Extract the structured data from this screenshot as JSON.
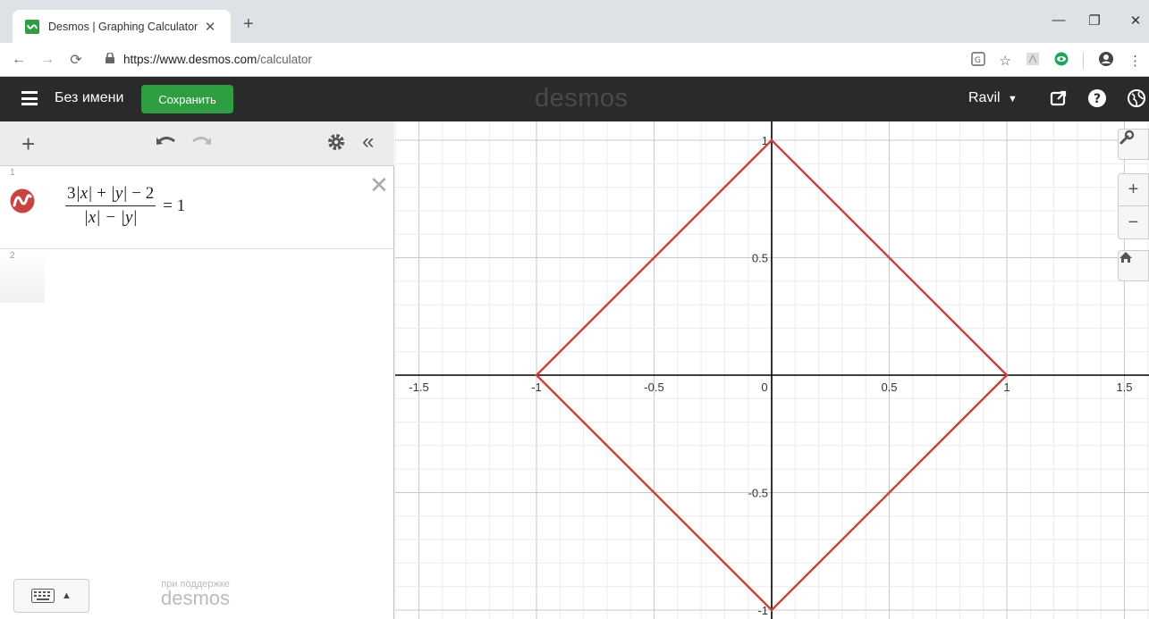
{
  "browser": {
    "tab_title": "Desmos | Graphing Calculator",
    "url_host": "https://www.desmos.com",
    "url_path": "/calculator"
  },
  "header": {
    "graph_title": "Без имени",
    "save_label": "Сохранить",
    "logo": "desmos",
    "user_name": "Ravil"
  },
  "expressions": [
    {
      "row": "1",
      "num_parts": [
        "3",
        "|x|",
        " + ",
        "|y|",
        " − 2"
      ],
      "numerator": "3|x| + |y| − 2",
      "denominator": "|x| − |y|",
      "rhs": "= 1",
      "color": "#c74440"
    },
    {
      "row": "2"
    }
  ],
  "footer": {
    "powered_small": "при поддержке",
    "powered_big": "desmos"
  },
  "graph": {
    "curve_color": "#c74440",
    "axis_color": "#000000",
    "x_ticks": [
      "-1.5",
      "-1",
      "-0.5",
      "0",
      "0.5",
      "1",
      "1.5"
    ],
    "y_ticks": [
      "1",
      "0.5",
      "-0.5",
      "-1"
    ],
    "curve": [
      [
        -1,
        0
      ],
      [
        0,
        1
      ],
      [
        1,
        0
      ],
      [
        0,
        -1
      ]
    ],
    "xlim": [
      -1.62,
      1.62
    ],
    "ylim": [
      -1.02,
      1.02
    ]
  }
}
